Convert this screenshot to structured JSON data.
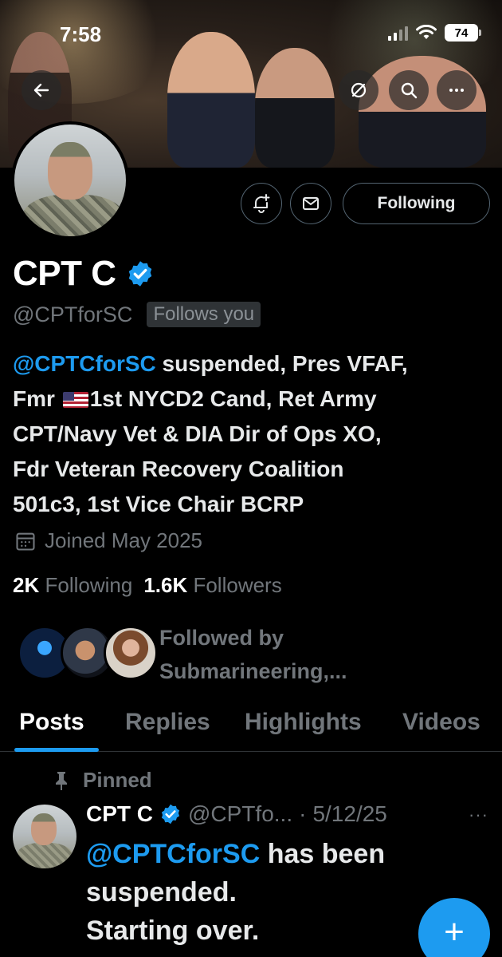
{
  "status_bar": {
    "time": "7:58",
    "battery": "74"
  },
  "profile": {
    "name": "CPT C",
    "handle": "@CPTforSC",
    "follows_you": "Follows you",
    "bio_mention": "@CPTCforSC",
    "bio_line1_rest": " suspended, Pres VFAF,",
    "bio_line2_a": "Fmr ",
    "bio_line2_b": "1st NYCD2 Cand, Ret Army",
    "bio_line3": "CPT/Navy Vet & DIA Dir of Ops XO,",
    "bio_line4": "Fdr Veteran Recovery Coalition",
    "bio_line5": "501c3, 1st Vice Chair BCRP",
    "joined": "Joined May 2025",
    "following_count": "2K",
    "following_label": "Following",
    "followers_count": "1.6K",
    "followers_label": "Followers",
    "followed_by_line1": "Followed by",
    "followed_by_line2": "Submarineering,..."
  },
  "actions": {
    "following_button": "Following"
  },
  "tabs": [
    {
      "label": "Posts",
      "active": true
    },
    {
      "label": "Replies",
      "active": false
    },
    {
      "label": "Highlights",
      "active": false
    },
    {
      "label": "Videos",
      "active": false
    }
  ],
  "post": {
    "pinned_label": "Pinned",
    "author_name": "CPT C",
    "author_handle": "@CPTfo...",
    "date": "5/12/25",
    "more": "···",
    "text_mention": "@CPTCforSC",
    "text_rest": " has been suspended.",
    "text_line3": "Starting over."
  },
  "fab": {
    "label": "+"
  },
  "colors": {
    "accent": "#1d9bf0",
    "muted": "#71767b",
    "background": "#000000"
  }
}
